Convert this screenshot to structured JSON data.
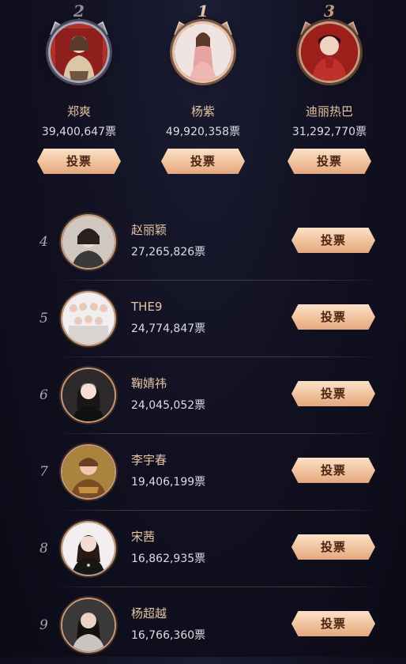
{
  "top3": [
    {
      "rank": "2",
      "name": "郑爽",
      "votes": "39,400,647票",
      "button": "投票",
      "avatar_color": "#b0302a"
    },
    {
      "rank": "1",
      "name": "杨紫",
      "votes": "49,920,358票",
      "button": "投票",
      "avatar_color": "#e9c0b6"
    },
    {
      "rank": "3",
      "name": "迪丽热巴",
      "votes": "31,292,770票",
      "button": "投票",
      "avatar_color": "#9c1f1c"
    }
  ],
  "list": [
    {
      "rank": "4",
      "name": "赵丽颖",
      "votes": "27,265,826票",
      "button": "投票"
    },
    {
      "rank": "5",
      "name": "THE9",
      "votes": "24,774,847票",
      "button": "投票"
    },
    {
      "rank": "6",
      "name": "鞠婧祎",
      "votes": "24,045,052票",
      "button": "投票"
    },
    {
      "rank": "7",
      "name": "李宇春",
      "votes": "19,406,199票",
      "button": "投票"
    },
    {
      "rank": "8",
      "name": "宋茜",
      "votes": "16,862,935票",
      "button": "投票"
    },
    {
      "rank": "9",
      "name": "杨超越",
      "votes": "16,766,360票",
      "button": "投票"
    }
  ],
  "colors": {
    "accent": "#e6c3a3",
    "button_dark_text": "#4a2412",
    "background": "#101020"
  }
}
